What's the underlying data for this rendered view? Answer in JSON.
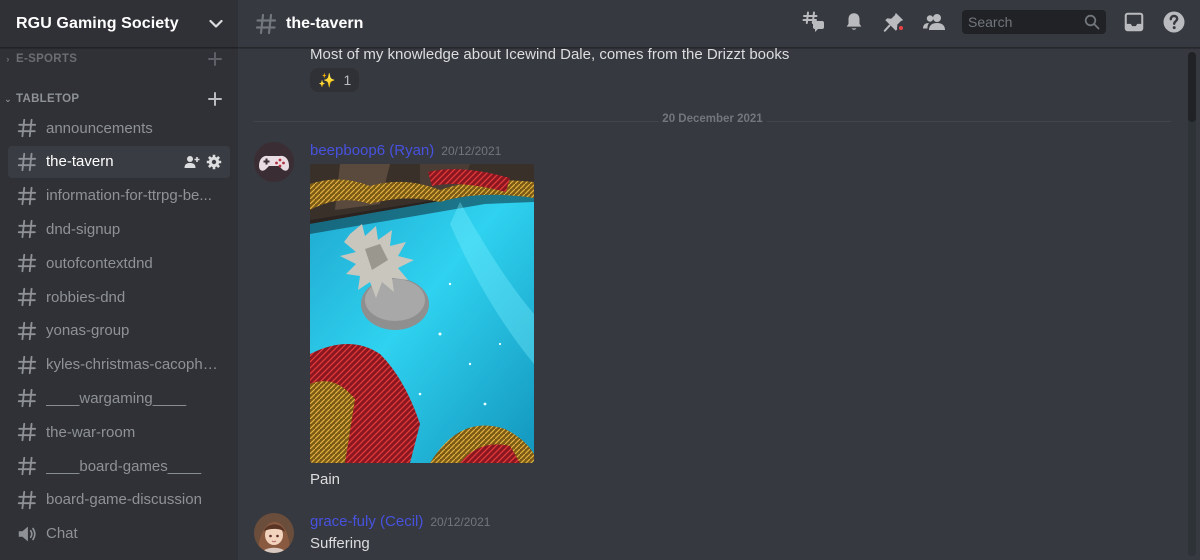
{
  "server": {
    "name": "RGU Gaming Society"
  },
  "categories": [
    {
      "label": "E-SPORTS",
      "collapsed": true
    },
    {
      "label": "TABLETOP",
      "collapsed": false
    }
  ],
  "channels": [
    {
      "label": "announcements",
      "type": "text"
    },
    {
      "label": "the-tavern",
      "type": "text",
      "active": true
    },
    {
      "label": "information-for-ttrpg-be...",
      "type": "text"
    },
    {
      "label": "dnd-signup",
      "type": "text"
    },
    {
      "label": "outofcontextdnd",
      "type": "text"
    },
    {
      "label": "robbies-dnd",
      "type": "text"
    },
    {
      "label": "yonas-group",
      "type": "text"
    },
    {
      "label": "kyles-christmas-cacopho...",
      "type": "text"
    },
    {
      "label": "____wargaming____",
      "type": "text"
    },
    {
      "label": "the-war-room",
      "type": "text"
    },
    {
      "label": "____board-games____",
      "type": "text"
    },
    {
      "label": "board-game-discussion",
      "type": "text"
    },
    {
      "label": "Chat",
      "type": "announcement"
    }
  ],
  "header": {
    "channel_name": "the-tavern"
  },
  "toolbar": {
    "search_placeholder": "Search",
    "icons": [
      "threads-icon",
      "bell-icon",
      "pin-icon",
      "members-icon",
      "inbox-icon",
      "help-icon"
    ]
  },
  "messages": {
    "continued_text": "Most of my knowledge about Icewind Dale, comes from the Drizzt books",
    "reaction": {
      "emoji": "✨",
      "count": "1"
    },
    "date_divider": "20 December 2021",
    "posts": [
      {
        "author": "beepboop6 (Ryan)",
        "timestamp": "20/12/2021",
        "text": "Pain",
        "has_image": true
      },
      {
        "author": "grace-fuly (Cecil)",
        "timestamp": "20/12/2021",
        "text": "Suffering",
        "has_image": false
      }
    ]
  },
  "colors": {
    "author_name": "#4752e0",
    "sidebar_bg": "#2f3136",
    "chat_bg": "#36393f",
    "notification_dot": "#ed4245"
  }
}
